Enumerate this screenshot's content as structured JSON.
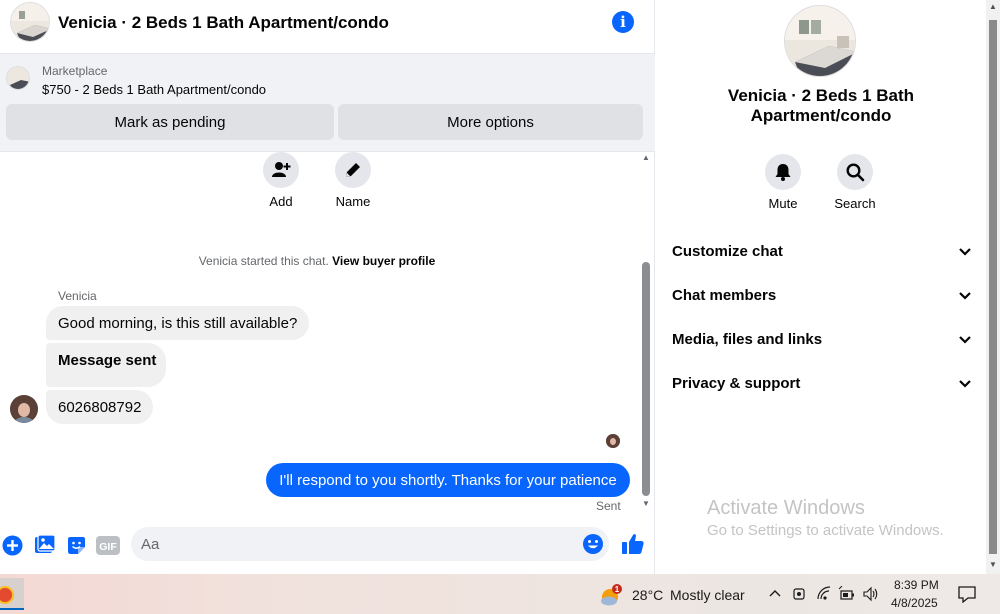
{
  "header": {
    "title": "Venicia · 2 Beds 1 Bath Apartment/condo",
    "info_icon": "i"
  },
  "marketplace": {
    "label": "Marketplace",
    "item": "$750 - 2 Beds 1 Bath Apartment/condo",
    "pending_button": "Mark as pending",
    "more_button": "More options"
  },
  "actions": {
    "add": "Add",
    "name": "Name"
  },
  "conversation": {
    "started_text": "Venicia started this chat.",
    "buyer_profile_link": "View buyer profile",
    "sender_name": "Venicia",
    "incoming": [
      "Good morning, is this still available?",
      "Message sent",
      "6026808792"
    ],
    "outgoing": "I'll respond to you shortly. Thanks for your patience",
    "status": "Sent"
  },
  "composer": {
    "placeholder": "Aa",
    "gif_label": "GIF"
  },
  "info_panel": {
    "title": "Venicia · 2 Beds 1 Bath Apartment/condo",
    "mute": "Mute",
    "search": "Search",
    "sections": [
      "Customize chat",
      "Chat members",
      "Media, files and links",
      "Privacy & support"
    ]
  },
  "watermark": {
    "line1": "Activate Windows",
    "line2": "Go to Settings to activate Windows."
  },
  "taskbar": {
    "weather_badge": "1",
    "temperature": "28°C",
    "condition": "Mostly clear",
    "time": "8:39 PM",
    "date": "4/8/2025"
  },
  "colors": {
    "accent": "#0866ff",
    "bubble_in": "#f0f0f0",
    "button_gray": "#e4e6eb"
  }
}
